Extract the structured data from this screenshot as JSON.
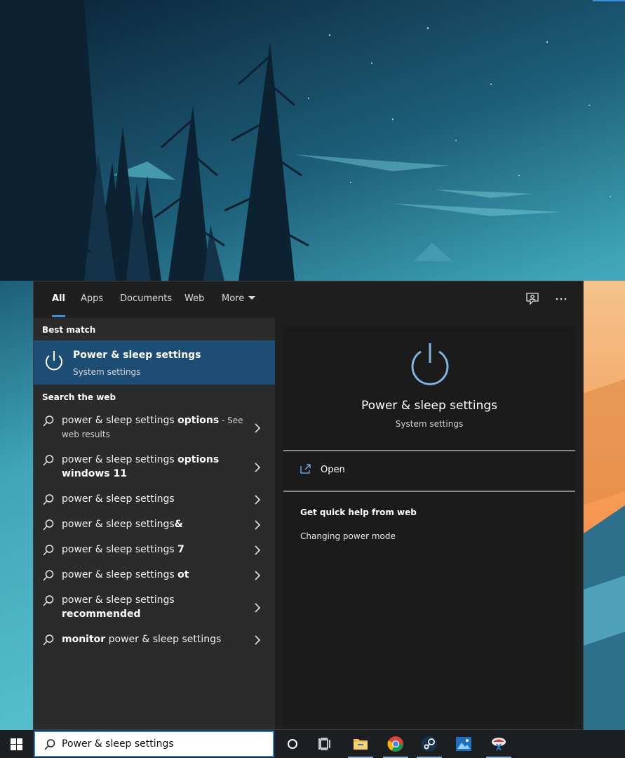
{
  "tabs": [
    {
      "label": "All",
      "active": true
    },
    {
      "label": "Apps",
      "active": false
    },
    {
      "label": "Documents",
      "active": false
    },
    {
      "label": "Web",
      "active": false
    },
    {
      "label": "More",
      "active": false
    }
  ],
  "toolbar_icons": [
    "feedback-icon",
    "more-options-icon"
  ],
  "best_match": {
    "header": "Best match",
    "title": "Power & sleep settings",
    "subtitle": "System settings",
    "icon": "power-icon"
  },
  "web_search": {
    "header": "Search the web",
    "items": [
      {
        "text": "power & sleep settings",
        "bold": "options",
        "note": " - See web results"
      },
      {
        "text": "power & sleep settings",
        "bold": "options windows 11",
        "note": ""
      },
      {
        "text": "power & sleep settings",
        "bold": "",
        "note": ""
      },
      {
        "text": "power & sleep settings",
        "bold": "&",
        "note": ""
      },
      {
        "text": "power & sleep settings",
        "bold": "7",
        "note": ""
      },
      {
        "text": "power & sleep settings",
        "bold": "ot",
        "note": ""
      },
      {
        "text": "power & sleep settings",
        "bold": "recommended",
        "note": ""
      },
      {
        "text": "power & sleep settings",
        "prefix_bold": "monitor",
        "bold": "",
        "note": ""
      }
    ]
  },
  "preview": {
    "title": "Power & sleep settings",
    "subtitle": "System settings",
    "open_label": "Open",
    "help_header": "Get quick help from web",
    "help_link": "Changing power mode"
  },
  "search_box": {
    "value": "Power & sleep settings"
  },
  "taskbar_apps": [
    "cortana",
    "task-view",
    "file-explorer",
    "chrome",
    "steam",
    "photos",
    "snipping-tool"
  ],
  "colors": {
    "accent": "#3a8fd8",
    "selected_row": "#1d4c74",
    "power_icon": "#7bb6e6"
  }
}
